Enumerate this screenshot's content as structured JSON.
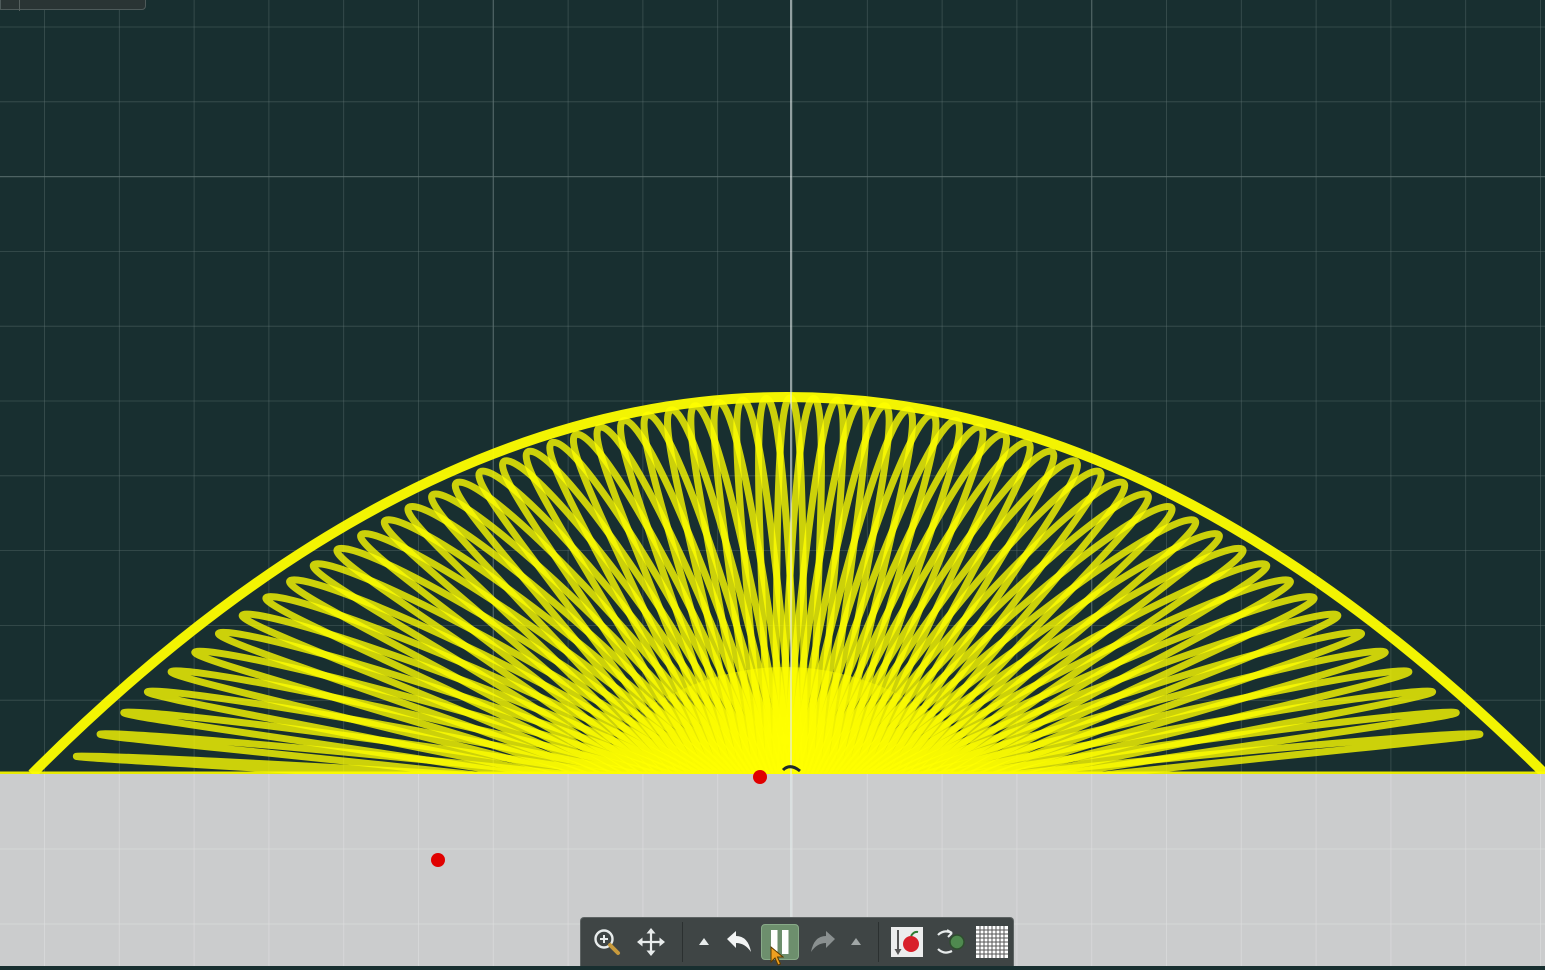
{
  "window": {
    "width": 1545,
    "height": 966
  },
  "canvas": {
    "background_color": "#182f30",
    "grid_color": "#5f7373",
    "ground_color": "#cbcccd",
    "spring_color": "#ffff00",
    "marker_color": "#e00000"
  },
  "toolbar": {
    "tools": [
      {
        "id": "zoom",
        "icon": "zoom-in-icon"
      },
      {
        "id": "pan",
        "icon": "move-arrows-icon"
      },
      {
        "id": "undo-menu",
        "icon": "triangle-up-icon"
      },
      {
        "id": "undo",
        "icon": "undo-arrow-icon"
      },
      {
        "id": "pause",
        "icon": "pause-icon",
        "active": true
      },
      {
        "id": "redo",
        "icon": "redo-arrow-icon",
        "enabled": false
      },
      {
        "id": "redo-menu",
        "icon": "triangle-up-icon"
      },
      {
        "id": "gravity",
        "icon": "gravity-apple-icon"
      },
      {
        "id": "forces",
        "icon": "rotate-body-icon"
      },
      {
        "id": "grid",
        "icon": "grid-icon"
      }
    ]
  }
}
